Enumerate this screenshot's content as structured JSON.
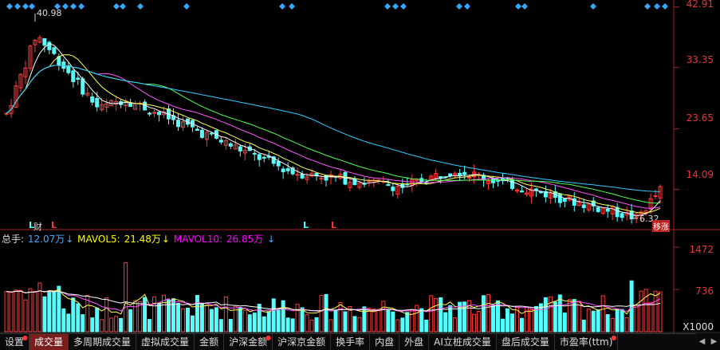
{
  "price_axis": [
    "42.91",
    "33.35",
    "23.65",
    "14.09"
  ],
  "volume_axis": [
    "1472",
    "736",
    "X1000"
  ],
  "annotations": {
    "high": "40.98",
    "low": "6.32",
    "end_tag": "移涨"
  },
  "event_markers": [
    {
      "text": "L",
      "color": "#4ff"
    },
    {
      "text": "财",
      "color": "#ddd"
    },
    {
      "text": "L",
      "color": "#f33"
    },
    {
      "text": "L",
      "color": "#4ff"
    },
    {
      "text": "L",
      "color": "#f33"
    }
  ],
  "volume_header": {
    "total_label": "总手:",
    "total_value": "12.07万",
    "ma5_label": "MAVOL5:",
    "ma5_value": "21.48万",
    "ma10_label": "MAVOL10:",
    "ma10_value": "26.85万",
    "arrow": "↓",
    "colors": {
      "total": "#4af",
      "ma5": "#ff0",
      "ma10": "#f0f"
    }
  },
  "tabs": [
    {
      "label": "设置",
      "active": false,
      "dot": true
    },
    {
      "label": "成交量",
      "active": true,
      "dot": false
    },
    {
      "label": "多周期成交量",
      "active": false,
      "dot": false
    },
    {
      "label": "虚拟成交量",
      "active": false,
      "dot": false
    },
    {
      "label": "金额",
      "active": false,
      "dot": false
    },
    {
      "label": "沪深金额",
      "active": false,
      "dot": true
    },
    {
      "label": "沪深京金额",
      "active": false,
      "dot": false
    },
    {
      "label": "换手率",
      "active": false,
      "dot": false
    },
    {
      "label": "内盘",
      "active": false,
      "dot": false
    },
    {
      "label": "外盘",
      "active": false,
      "dot": false
    },
    {
      "label": "AI立桩成交量",
      "active": false,
      "dot": false
    },
    {
      "label": "盘后成交量",
      "active": false,
      "dot": false
    },
    {
      "label": "市盈率(ttm)",
      "active": false,
      "dot": true
    }
  ],
  "tab_scroll": {
    "left": "◀",
    "right": "▶"
  },
  "colors": {
    "up": "#ff3b3b",
    "down": "#55ffff",
    "ma5": "#ffffff",
    "ma10": "#ffff55",
    "ma20": "#ff55ff",
    "ma30": "#55ff55",
    "ma60": "#33ccff",
    "axis": "#aa2222",
    "background": "#000000"
  },
  "chart_data": {
    "type": "candlestick",
    "price_ticks": [
      42.91,
      33.35,
      23.65,
      14.09
    ],
    "ylim": [
      8.0,
      43.5
    ],
    "high_mark": 40.98,
    "low_mark": 6.32,
    "volume_ticks_thousands": [
      1472,
      736
    ],
    "volume_max_thousands": 1500
  }
}
